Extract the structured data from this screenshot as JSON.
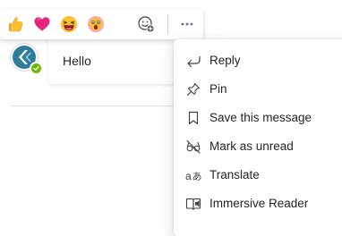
{
  "colors": {
    "accent": "#6264a7",
    "presence": "#6bb700",
    "avatar_brand": "#2e7d9a",
    "text": "#242424"
  },
  "message": {
    "text": "Hello",
    "avatar_icon": "brand-logo-icon",
    "presence_icon": "available-check-icon"
  },
  "reactions": [
    {
      "icon": "like-icon"
    },
    {
      "icon": "heart-icon"
    },
    {
      "icon": "laugh-icon"
    },
    {
      "icon": "surprised-icon"
    },
    {
      "icon": "add-reaction-icon"
    }
  ],
  "more_options_icon": "more-options-icon",
  "context_menu": {
    "items": [
      {
        "label": "Reply",
        "icon": "reply-icon"
      },
      {
        "label": "Pin",
        "icon": "pin-icon"
      },
      {
        "label": "Save this message",
        "icon": "bookmark-icon"
      },
      {
        "label": "Mark as unread",
        "icon": "unread-eye-icon"
      },
      {
        "label": "Translate",
        "icon": "translate-icon"
      },
      {
        "label": "Immersive Reader",
        "icon": "immersive-reader-icon"
      }
    ]
  }
}
